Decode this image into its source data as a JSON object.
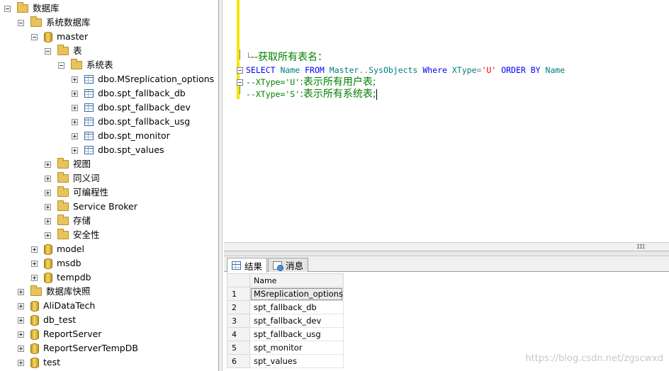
{
  "tree": {
    "root": "数据库",
    "system_databases": "系统数据库",
    "master": "master",
    "tables_folder": "表",
    "system_tables_folder": "系统表",
    "system_tables": [
      "dbo.MSreplication_options",
      "dbo.spt_fallback_db",
      "dbo.spt_fallback_dev",
      "dbo.spt_fallback_usg",
      "dbo.spt_monitor",
      "dbo.spt_values"
    ],
    "master_folders": [
      "视图",
      "同义词",
      "可编程性",
      "Service Broker",
      "存储",
      "安全性"
    ],
    "system_db_others": [
      "model",
      "msdb",
      "tempdb"
    ],
    "snapshots_folder": "数据库快照",
    "user_databases": [
      "AliDataTech",
      "db_test",
      "ReportServer",
      "ReportServerTempDB",
      "test"
    ]
  },
  "editor": {
    "comment_title": "--获取所有表名：",
    "sql": {
      "select": "SELECT",
      "name": "Name",
      "from": "FROM",
      "master": "Master",
      "dots": "..",
      "sysobjects": "SysObjects",
      "where": "Where",
      "xtype": "XType",
      "eq": "=",
      "u_literal": "'U'",
      "order_by": "ORDER BY",
      "name2": "Name"
    },
    "comment_u_code": "--XType='U'",
    "comment_u_text": ":表示所有用户表;",
    "comment_s_code": "--XType='S'",
    "comment_s_text": ":表示所有系统表;"
  },
  "results": {
    "tab_results": "结果",
    "tab_messages": "消息",
    "column_header": "Name",
    "rows": [
      {
        "n": "1",
        "name": "MSreplication_options"
      },
      {
        "n": "2",
        "name": "spt_fallback_db"
      },
      {
        "n": "3",
        "name": "spt_fallback_dev"
      },
      {
        "n": "4",
        "name": "spt_fallback_usg"
      },
      {
        "n": "5",
        "name": "spt_monitor"
      },
      {
        "n": "6",
        "name": "spt_values"
      }
    ]
  },
  "scroll_grip": "III",
  "watermark": "https://blog.csdn.net/zgscwxd",
  "colors": {
    "keyword": "#0000ff",
    "object": "#008080",
    "string": "#ff0000",
    "comment": "#008000",
    "change_bar": "#f2e600"
  }
}
